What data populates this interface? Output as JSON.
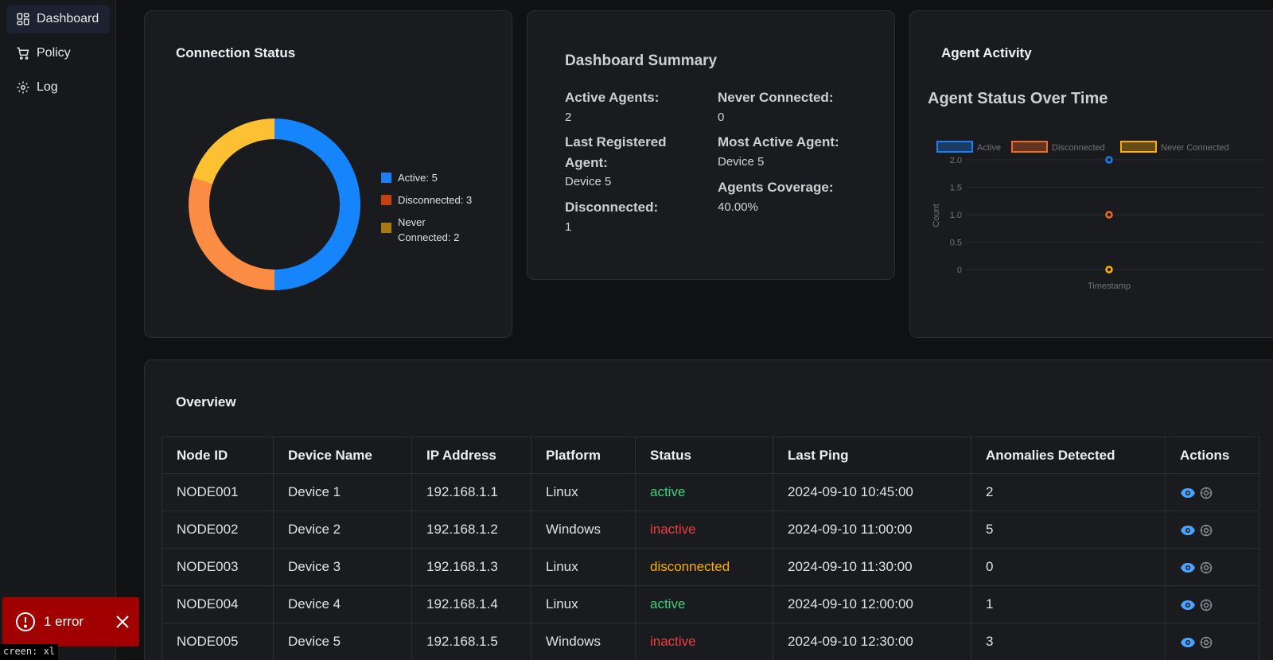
{
  "sidebar": {
    "items": [
      {
        "label": "Dashboard",
        "icon": "dashboard-icon",
        "active": true
      },
      {
        "label": "Policy",
        "icon": "cart-icon",
        "active": false
      },
      {
        "label": "Log",
        "icon": "gear-icon",
        "active": false
      }
    ]
  },
  "connection_status": {
    "title": "Connection Status",
    "legend": [
      {
        "label": "Active: 5",
        "color": "#1c7ef2"
      },
      {
        "label": "Disconnected: 3",
        "color": "#f06a25"
      },
      {
        "label": "Never Connected: 2",
        "color": "#a87a10"
      }
    ],
    "donut_colors": {
      "active": "#1685fb",
      "disconnected": "#fd8c44",
      "never": "#fcc032"
    }
  },
  "summary": {
    "title": "Dashboard Summary",
    "active_label": "Active Agents:",
    "active_value": "2",
    "never_label": "Never Connected:",
    "never_value": "0",
    "last_reg_label": "Last Registered Agent:",
    "last_reg_value": "Device 5",
    "most_active_label": "Most Active Agent:",
    "most_active_value": "Device 5",
    "disconnected_label": "Disconnected:",
    "disconnected_value": "1",
    "coverage_label": "Agents Coverage:",
    "coverage_value": "40.00%"
  },
  "agent_activity": {
    "title": "Agent Activity",
    "chart_title": "Agent Status Over Time"
  },
  "chart_data": {
    "type": "scatter",
    "title": "Agent Status Over Time",
    "xlabel": "Timestamp",
    "ylabel": "Count",
    "ylim": [
      0,
      2
    ],
    "yticks": [
      "2.0",
      "1.5",
      "1.0",
      "0.5",
      "0"
    ],
    "series": [
      {
        "name": "Active",
        "color": "#1c7ef2",
        "values": [
          2
        ]
      },
      {
        "name": "Disconnected",
        "color": "#f06a25",
        "values": [
          1
        ]
      },
      {
        "name": "Never Connected",
        "color": "#fab005",
        "values": [
          0
        ]
      }
    ],
    "legend_position": "top"
  },
  "overview": {
    "title": "Overview",
    "columns": [
      "Node ID",
      "Device Name",
      "IP Address",
      "Platform",
      "Status",
      "Last Ping",
      "Anomalies Detected",
      "Actions"
    ],
    "rows": [
      [
        "NODE001",
        "Device 1",
        "192.168.1.1",
        "Linux",
        "active",
        "2024-09-10 10:45:00",
        "2"
      ],
      [
        "NODE002",
        "Device 2",
        "192.168.1.2",
        "Windows",
        "inactive",
        "2024-09-10 11:00:00",
        "5"
      ],
      [
        "NODE003",
        "Device 3",
        "192.168.1.3",
        "Linux",
        "disconnected",
        "2024-09-10 11:30:00",
        "0"
      ],
      [
        "NODE004",
        "Device 4",
        "192.168.1.4",
        "Linux",
        "active",
        "2024-09-10 12:00:00",
        "1"
      ],
      [
        "NODE005",
        "Device 5",
        "192.168.1.5",
        "Windows",
        "inactive",
        "2024-09-10 12:30:00",
        "3"
      ]
    ]
  },
  "error_toast": {
    "label": "1 error"
  },
  "screen_tag": "creen: xl"
}
